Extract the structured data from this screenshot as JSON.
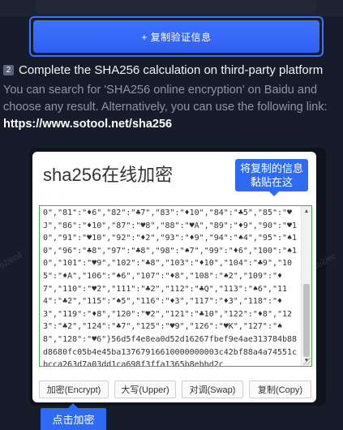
{
  "copy_button": {
    "label": "+ 复制验证信息"
  },
  "step": {
    "number": "2",
    "title": "Complete the SHA256 calculation on third-party platform",
    "desc_prefix": "You can search for 'SHA256 online encryption' on Baidu and choose any result. Alternatively, you can use the following link: ",
    "link": "https://www.sotool.net/sha256"
  },
  "tool": {
    "title": "sha256在线加密",
    "tip_paste": "将复制的信息黏贴在这",
    "textarea_value": "0\",\"81\":\"♦6\",\"82\":\"♣7\",\"83\":\"♦10\",\"84\":\"♣5\",\"85\":\"♥J\",\"86\":\"♦10\",\"87\":\"♥8\",\"88\":\"♥A\",\"89\":\"♦9\",\"90\":\"♥10\",\"91\":\"♥10\",\"92\":\"♦2\",\"93\":\"♦9\",\"94\":\"♠4\",\"95\":\"♠10\",\"96\":\"♣8\",\"97\":\"♣8\",\"98\":\"♠7\",\"99\":\"♦6\",\"100\":\"♠10\",\"101\":\"♥9\",\"102\":\"♣8\",\"103\":\"♦10\",\"104\":\"♣9\",\"105\":\"♦A\",\"106\":\"♠6\",\"107\":\"♦8\",\"108\":\"♠2\",\"109\":\"♦7\",\"110\":\"♥2\",\"111\":\"♣2\",\"112\":\"♣Q\",\"113\":\"♠6\",\"114\":\"♣2\",\"115\":\"♠5\",\"116\":\"♦3\",\"117\":\"♦3\",\"118\":\"♦3\",\"119\":\"♦8\",\"120\":\"♥2\",\"121\":\"♣10\",\"122\":\"♦8\",\"123\":\"♣2\",\"124\":\"♣7\",\"125\":\"♥9\",\"126\":\"♥K\",\"127\":\"♠8\",\"128\":\"♥6\"}56d5f4e8ea0d52d16267fbef9e4ae313784b88d8680fc05b4e45ba13767916610000000003c42bf88a4a74551cbcca263d7a03dd1ca698f3ffa1365b8ebbd2c",
    "buttons": {
      "encrypt": "加密(Encrypt)",
      "upper": "大写(Upper)",
      "swap": "对调(Swap)",
      "copy": "复制(Copy)"
    },
    "tip_click": "点击加密"
  },
  "colors": {
    "accent": "#2f6bf2",
    "background": "#171c2b",
    "textarea_border": "#4aa84a"
  }
}
